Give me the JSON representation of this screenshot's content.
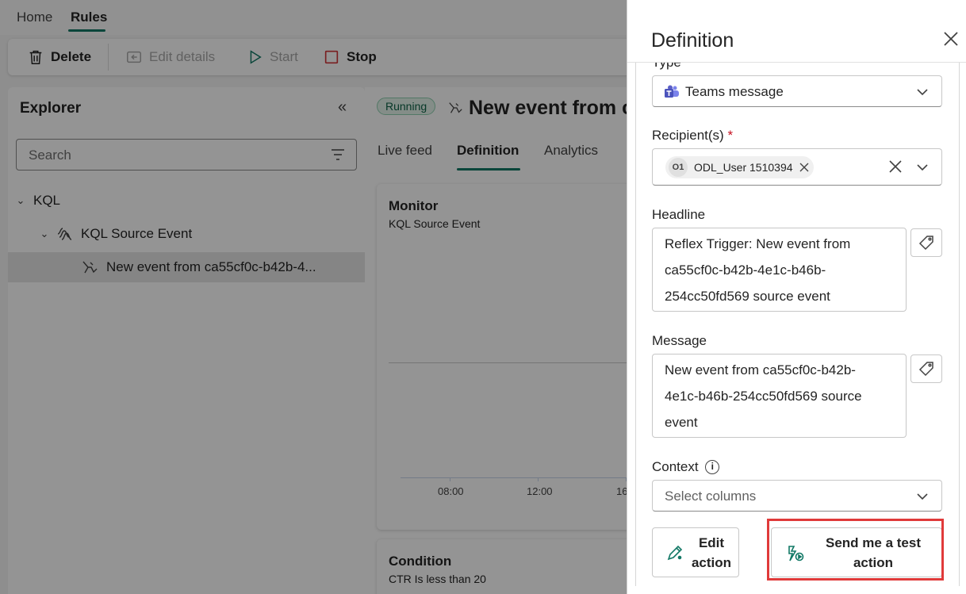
{
  "nav": {
    "home": "Home",
    "rules": "Rules"
  },
  "toolbar": {
    "delete": "Delete",
    "edit_details": "Edit details",
    "start": "Start",
    "stop": "Stop"
  },
  "explorer": {
    "title": "Explorer",
    "search_placeholder": "Search",
    "tree": [
      {
        "label": "KQL"
      },
      {
        "label": "KQL Source Event"
      },
      {
        "label": "New event from ca55cf0c-b42b-4..."
      }
    ]
  },
  "main": {
    "status": "Running",
    "rule_name": "New event from c",
    "tabs": [
      "Live feed",
      "Definition",
      "Analytics"
    ],
    "monitor": {
      "title": "Monitor",
      "subtitle": "KQL Source Event",
      "ticks": [
        "08:00",
        "12:00",
        "16"
      ]
    },
    "condition": {
      "title": "Condition",
      "subtitle": "CTR Is less than 20"
    }
  },
  "panel": {
    "title": "Definition",
    "type_label": "Type",
    "type_value": "Teams message",
    "recipients_label": "Recipient(s)",
    "required_mark": "*",
    "recipient_chip": {
      "initials": "O1",
      "name": "ODL_User 1510394"
    },
    "headline_label": "Headline",
    "headline_lines": [
      "Reflex Trigger: New event from",
      "ca55cf0c-b42b-4e1c-b46b-",
      "254cc50fd569 source event"
    ],
    "message_label": "Message",
    "message_lines": [
      "New event from ca55cf0c-b42b-",
      "4e1c-b46b-254cc50fd569 source",
      "event"
    ],
    "context_label": "Context",
    "context_placeholder": "Select columns",
    "edit_action_lines": [
      "Edit",
      "action"
    ],
    "test_action_lines": [
      "Send me a test",
      "action"
    ]
  },
  "colors": {
    "accent": "#117865",
    "highlight": "#e03a3a",
    "stop": "#d13438",
    "teams": "#5b5fc7"
  }
}
